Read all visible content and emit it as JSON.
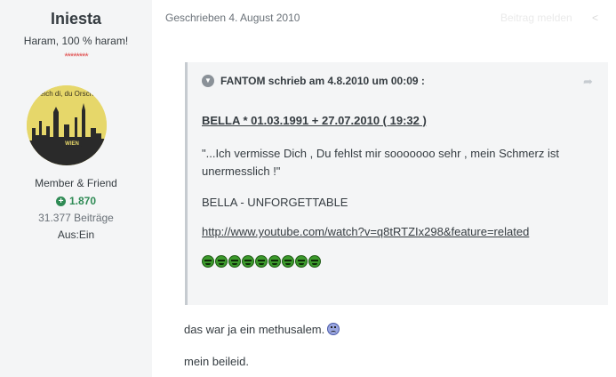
{
  "author": {
    "name": "Iniesta",
    "title": "Haram, 100 % haram!",
    "stars": "********",
    "avatar_text": "eich di, du Orsch",
    "avatar_badge": "WIEN",
    "group": "Member & Friend",
    "reputation": "1.870",
    "posts": "31.377 Beiträge",
    "status": "Aus:Ein"
  },
  "post": {
    "date": "Geschrieben 4. August 2010",
    "report_label": "Beitrag melden",
    "share_icon": "share-icon"
  },
  "quote": {
    "header": "FANTOM schrieb am 4.8.2010 um 00:09 :",
    "title": "BELLA * 01.03.1991 + 27.07.2010 ( 19:32 )",
    "text": "\"...Ich vermisse Dich , Du fehlst mir sooooooo sehr , mein Schmerz ist unermesslich !\"",
    "line2": "BELLA - UNFORGETTABLE",
    "link": "http://www.youtube.com/watch?v=q8tRTZIx298&feature=related",
    "smiley_count": 9
  },
  "body": {
    "line1": "das war ja ein methusalem.",
    "line2": "mein beileid."
  },
  "colors": {
    "sidebar_bg": "#f4f5f6",
    "reputation_green": "#2f8b55",
    "stars_red": "#e05050"
  }
}
